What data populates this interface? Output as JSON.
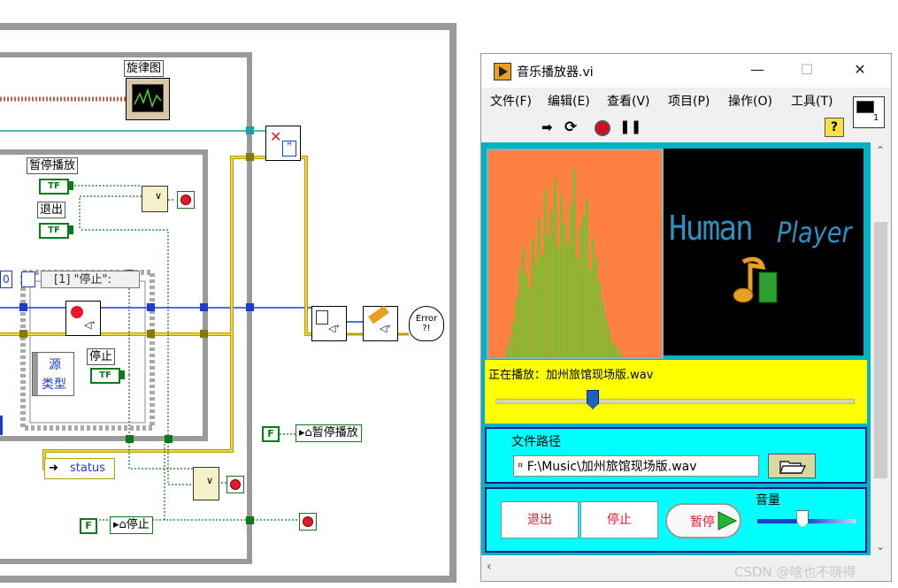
{
  "diagram": {
    "melody_graph_label": "旋律图",
    "pause_play_label": "暂停播放",
    "exit_label": "退出",
    "stop_label": "停止",
    "case_selector_text": "[1] \"停止\":",
    "case_index_left": "0",
    "source_label": "源",
    "type_label": "类型",
    "status_label": "status",
    "tf_text": "TF",
    "false_const": "F",
    "local_pause_play": "暂停播放",
    "local_stop": "停止",
    "error_text": "Error ?!",
    "or_symbol": "∨"
  },
  "window": {
    "title": "音乐播放器.vi",
    "controls": {
      "minimize": "—",
      "maximize": "☐",
      "close": "✕"
    },
    "menu": [
      {
        "label": "文件(F)"
      },
      {
        "label": "编辑(E)"
      },
      {
        "label": "查看(V)"
      },
      {
        "label": "项目(P)"
      },
      {
        "label": "操作(O)"
      },
      {
        "label": "工具(T)"
      }
    ],
    "help_icon_text": "?",
    "vi_icon_text": "1"
  },
  "panel": {
    "logo_word1": "Human",
    "logo_word2": "Player",
    "now_playing": "正在播放：加州旅馆现场版.wav",
    "seek_position": 0.27,
    "path_label": "文件路径",
    "path_value": "F:\\Music\\加州旅馆现场版.wav",
    "path_prefix_icon": "ꟸ",
    "exit_button": "退出",
    "stop_button": "停止",
    "pause_button": "暂停",
    "volume_label": "音量",
    "volume_level": 0.45
  },
  "watermark": "CSDN @啥也不晓得",
  "colors": {
    "panel_bg": "#00b2c3",
    "spectrum_bg": "#ff8040",
    "spectrum_bars": "#4ed22c",
    "now_playing_bg": "#ffff00",
    "section_bg": "#00ffff",
    "logo_text": "#2f8fc0",
    "button_text": "#e8182c"
  },
  "spectrum_bars": [
    0.05,
    0.1,
    0.18,
    0.3,
    0.45,
    0.55,
    0.42,
    0.35,
    0.6,
    0.48,
    0.7,
    0.52,
    0.85,
    0.62,
    0.74,
    0.9,
    0.55,
    0.82,
    0.68,
    0.58,
    0.77,
    0.95,
    0.5,
    0.66,
    0.72,
    0.8,
    0.44,
    0.6,
    0.5,
    0.38,
    0.28,
    0.2,
    0.14,
    0.08,
    0.05,
    0.04
  ]
}
